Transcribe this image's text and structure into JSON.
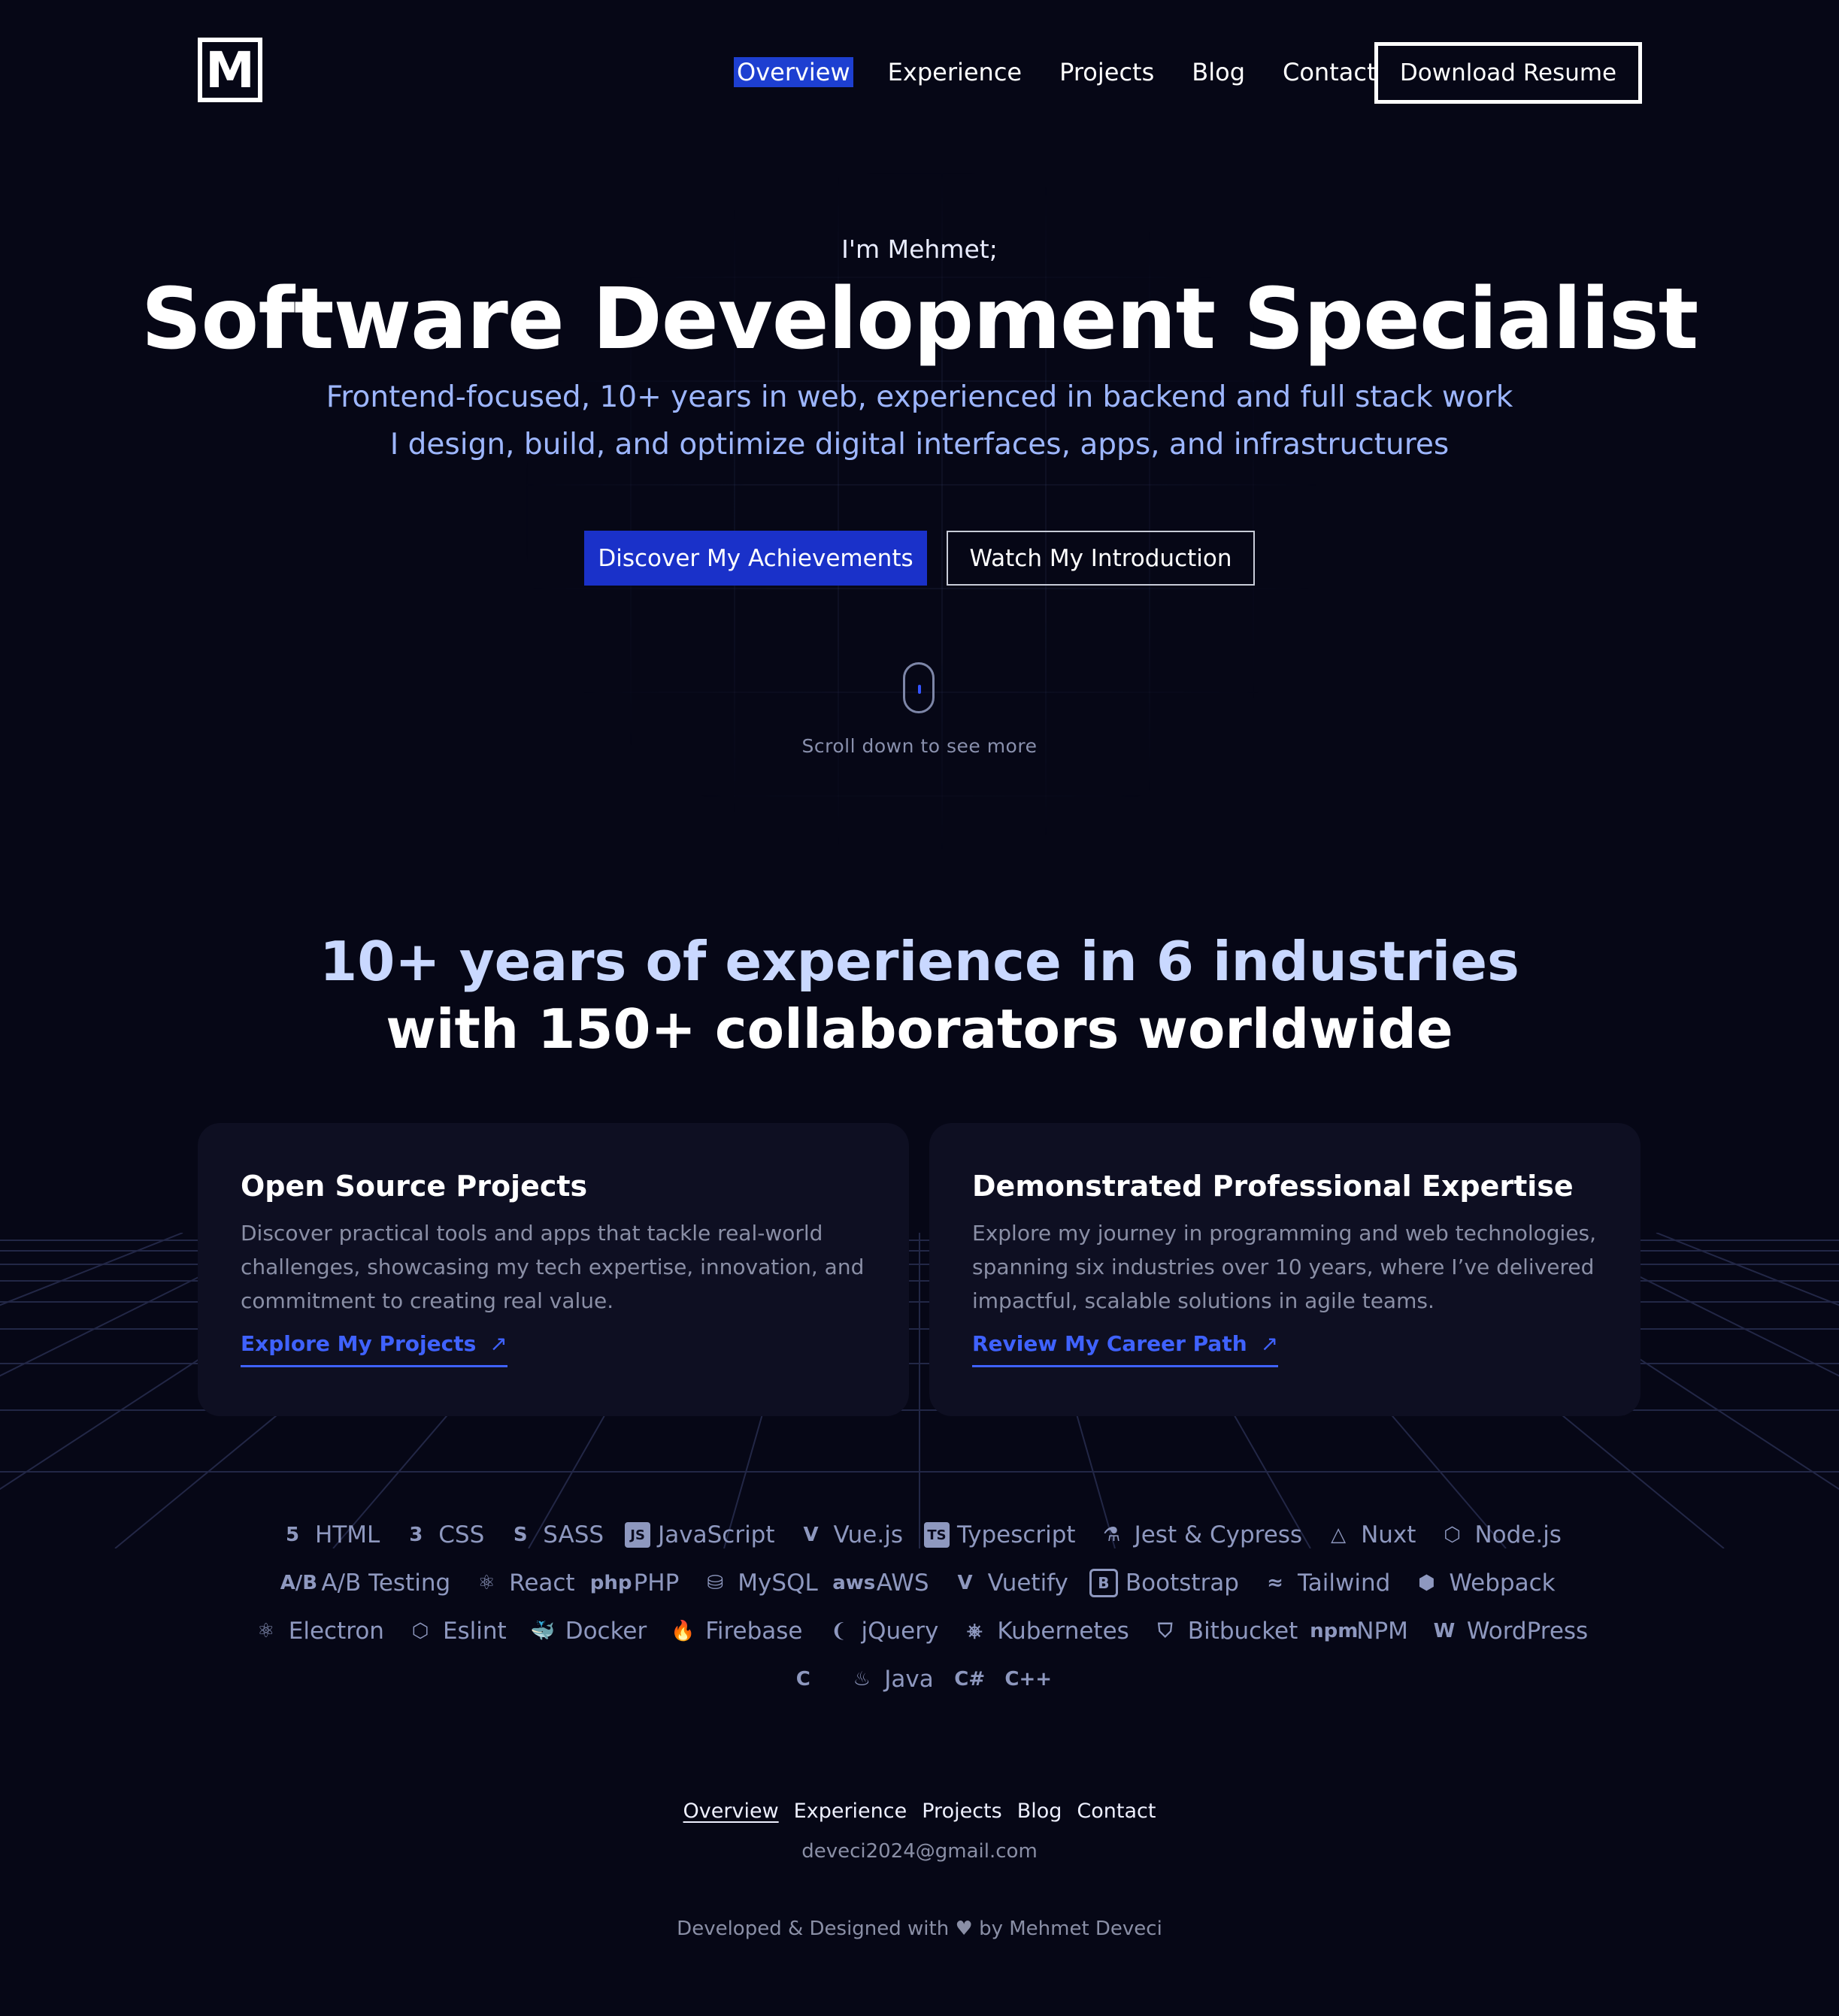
{
  "header": {
    "logo": "M",
    "nav": [
      "Overview",
      "Experience",
      "Projects",
      "Blog",
      "Contact"
    ],
    "resume_label": "Download Resume"
  },
  "hero": {
    "intro": "I'm Mehmet;",
    "title": "Software Development Specialist",
    "subtitle_line1": "Frontend-focused, 10+ years in web, experienced in backend and full stack work",
    "subtitle_line2": "I design, build, and optimize digital interfaces, apps, and infrastructures",
    "primary_button": "Discover My Achievements",
    "secondary_button": "Watch My Introduction",
    "scroll_hint": "Scroll down to see more"
  },
  "stats": {
    "line1": "10+ years of experience in 6 industries",
    "line2": "with 150+ collaborators worldwide"
  },
  "cards": [
    {
      "title": "Open Source Projects",
      "body": "Discover practical tools and apps that tackle real-world challenges, showcasing my tech expertise, innovation, and commitment to creating real value.",
      "link": "Explore My Projects",
      "arrow": "↗"
    },
    {
      "title": "Demonstrated Professional Expertise",
      "body": "Explore my journey in programming and web technologies, spanning six industries over 10 years, where I’ve delivered impactful, scalable solutions in agile teams.",
      "link": "Review My Career Path",
      "arrow": "↗"
    }
  ],
  "tech": {
    "row1": [
      {
        "label": "HTML",
        "icon": "html5-icon",
        "glyph": "5"
      },
      {
        "label": "CSS",
        "icon": "css3-icon",
        "glyph": "3"
      },
      {
        "label": "SASS",
        "icon": "sass-icon",
        "glyph": "S"
      },
      {
        "label": "JavaScript",
        "icon": "javascript-icon",
        "glyph": "JS"
      },
      {
        "label": "Vue.js",
        "icon": "vue-icon",
        "glyph": "V"
      },
      {
        "label": "Typescript",
        "icon": "typescript-icon",
        "glyph": "TS"
      },
      {
        "label": "Jest & Cypress",
        "icon": "test-tube-icon",
        "glyph": "⚗"
      },
      {
        "label": "Nuxt",
        "icon": "nuxt-icon",
        "glyph": "△"
      },
      {
        "label": "Node.js",
        "icon": "nodejs-icon",
        "glyph": "⬡"
      }
    ],
    "row2": [
      {
        "label": "A/B Testing",
        "icon": "ab-testing-icon",
        "glyph": "A/B"
      },
      {
        "label": "React",
        "icon": "react-icon",
        "glyph": "⚛"
      },
      {
        "label": "PHP",
        "icon": "php-icon",
        "glyph": "php"
      },
      {
        "label": "MySQL",
        "icon": "mysql-icon",
        "glyph": "⛁"
      },
      {
        "label": "AWS",
        "icon": "aws-icon",
        "glyph": "aws"
      },
      {
        "label": "Vuetify",
        "icon": "vuetify-icon",
        "glyph": "V"
      },
      {
        "label": "Bootstrap",
        "icon": "bootstrap-icon",
        "glyph": "B"
      },
      {
        "label": "Tailwind",
        "icon": "tailwind-icon",
        "glyph": "≈"
      },
      {
        "label": "Webpack",
        "icon": "webpack-icon",
        "glyph": "⬢"
      }
    ],
    "row3": [
      {
        "label": "Electron",
        "icon": "electron-icon",
        "glyph": "⚛"
      },
      {
        "label": "Eslint",
        "icon": "eslint-icon",
        "glyph": "⬡"
      },
      {
        "label": "Docker",
        "icon": "docker-icon",
        "glyph": "🐳"
      },
      {
        "label": "Firebase",
        "icon": "firebase-icon",
        "glyph": "🔥"
      },
      {
        "label": "jQuery",
        "icon": "jquery-icon",
        "glyph": "❨"
      },
      {
        "label": "Kubernetes",
        "icon": "kubernetes-icon",
        "glyph": "⎈"
      },
      {
        "label": "Bitbucket",
        "icon": "bitbucket-icon",
        "glyph": "⛉"
      },
      {
        "label": "NPM",
        "icon": "npm-icon",
        "glyph": "npm"
      },
      {
        "label": "WordPress",
        "icon": "wordpress-icon",
        "glyph": "W"
      }
    ],
    "row4": [
      {
        "label": "",
        "icon": "c-language-icon",
        "glyph": "C"
      },
      {
        "label": "Java",
        "icon": "java-icon",
        "glyph": "♨"
      },
      {
        "label": "",
        "icon": "csharp-icon",
        "glyph": "C#"
      },
      {
        "label": "",
        "icon": "cplusplus-icon",
        "glyph": "C++"
      }
    ]
  },
  "footer": {
    "nav": [
      "Overview",
      "Experience",
      "Projects",
      "Blog",
      "Contact"
    ],
    "email": "deveci2024@gmail.com",
    "credit_prefix": "Developed & Designed with",
    "credit_suffix": "by Mehmet Deveci"
  },
  "colors": {
    "background": "#060716",
    "accent": "#1a31c9",
    "link": "#3f62ff",
    "muted": "#8a8fa6"
  }
}
